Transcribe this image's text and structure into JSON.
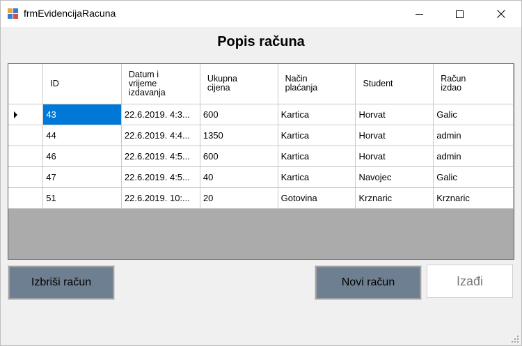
{
  "window": {
    "title": "frmEvidencijaRacuna"
  },
  "heading": "Popis računa",
  "grid": {
    "columns": [
      "ID",
      "Datum i\nvrijeme\nizdavanja",
      "Ukupna\ncijena",
      "Način\nplaćanja",
      "Student",
      "Račun\nizdao"
    ],
    "rows": [
      [
        "43",
        "22.6.2019. 4:3...",
        "600",
        "Kartica",
        "Horvat",
        "Galic"
      ],
      [
        "44",
        "22.6.2019. 4:4...",
        "1350",
        "Kartica",
        "Horvat",
        "admin"
      ],
      [
        "46",
        "22.6.2019. 4:5...",
        "600",
        "Kartica",
        "Horvat",
        "admin"
      ],
      [
        "47",
        "22.6.2019. 4:5...",
        "40",
        "Kartica",
        "Navojec",
        "Galic"
      ],
      [
        "51",
        "22.6.2019. 10:...",
        "20",
        "Gotovina",
        "Krznaric",
        "Krznaric"
      ]
    ],
    "selected_row": 0
  },
  "buttons": {
    "delete": "Izbriši račun",
    "new": "Novi račun",
    "exit": "Izađi"
  },
  "colors": {
    "selection": "#0078d7",
    "button_face": "#6e7f91",
    "grid_background": "#ababab"
  }
}
